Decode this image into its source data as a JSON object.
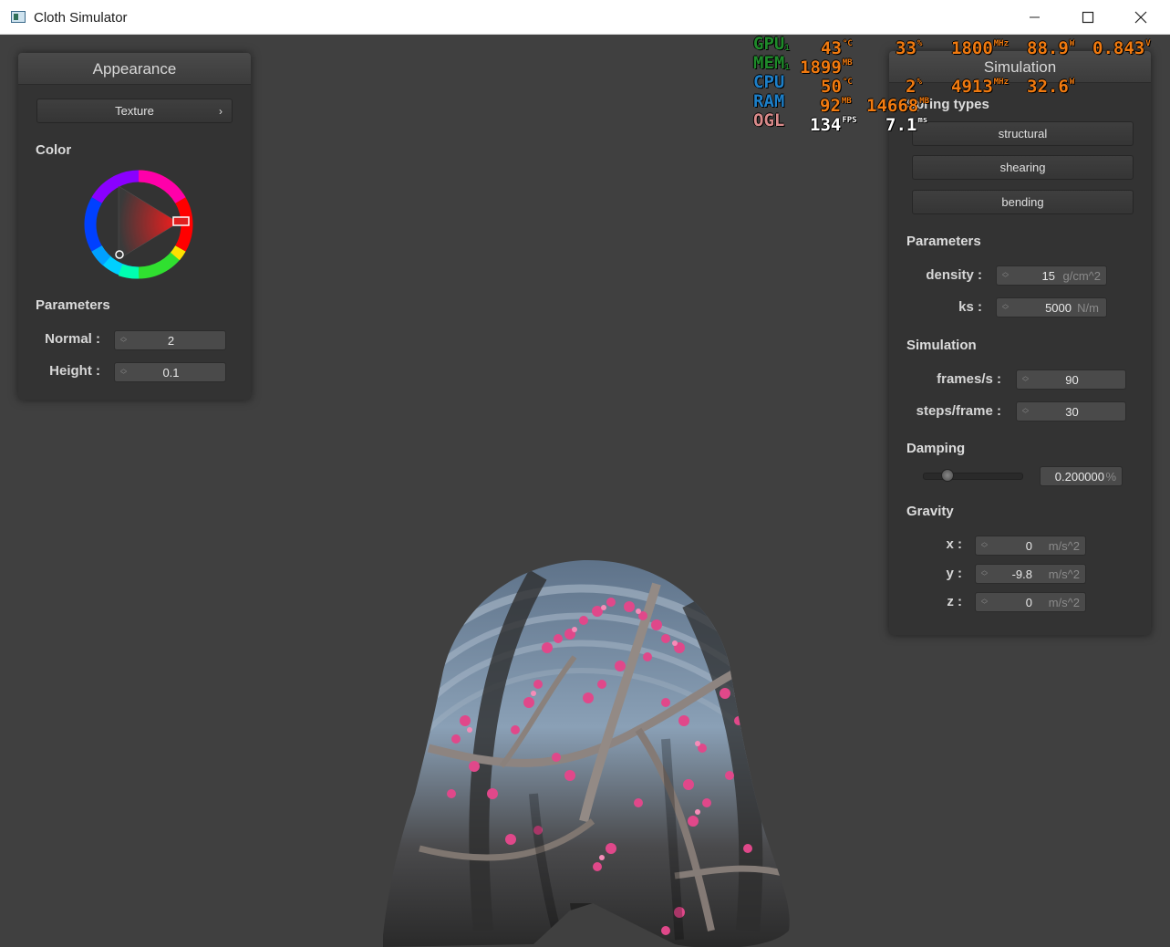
{
  "window": {
    "title": "Cloth Simulator"
  },
  "appearance": {
    "header": "Appearance",
    "texture_button": "Texture",
    "color_label": "Color",
    "color_value": "#d81e1e",
    "parameters_label": "Parameters",
    "normal_label": "Normal :",
    "normal_value": "2",
    "height_label": "Height :",
    "height_value": "0.1"
  },
  "simulation": {
    "header": "Simulation",
    "spring_types_label": "Spring types",
    "buttons": [
      "structural",
      "shearing",
      "bending"
    ],
    "parameters_label": "Parameters",
    "density_label": "density :",
    "density_value": "15",
    "density_unit": "g/cm^2",
    "ks_label": "ks :",
    "ks_value": "5000",
    "ks_unit": "N/m",
    "simulation_label": "Simulation",
    "fps_label": "frames/s :",
    "fps_value": "90",
    "steps_label": "steps/frame :",
    "steps_value": "30",
    "damping_label": "Damping",
    "damping_value": "0.200000",
    "damping_unit": "%",
    "damping_slider_fraction": 0.2,
    "gravity_label": "Gravity",
    "gx_label": "x :",
    "gx_value": "0",
    "gy_label": "y :",
    "gy_value": "-9.8",
    "gz_label": "z :",
    "gz_value": "0",
    "gravity_unit": "m/s^2"
  },
  "osd": {
    "gpu": {
      "label": "GPU",
      "sub": "1",
      "temp": "43",
      "temp_unit": "°C",
      "load": "33",
      "load_unit": "%",
      "clock": "1800",
      "clock_unit": "MHz",
      "power": "88.9",
      "power_unit": "W",
      "volt": "0.843",
      "volt_unit": "V"
    },
    "mem": {
      "label": "MEM",
      "sub": "1",
      "used": "1899",
      "used_unit": "MB"
    },
    "cpu": {
      "label": "CPU",
      "temp": "50",
      "temp_unit": "°C",
      "load": "2",
      "load_unit": "%",
      "clock": "4913",
      "clock_unit": "MHz",
      "power": "32.6",
      "power_unit": "W"
    },
    "ram": {
      "label": "RAM",
      "used": "92",
      "used_unit": "MB",
      "total": "14668",
      "total_unit": "MB"
    },
    "ogl": {
      "label": "OGL",
      "fps": "134",
      "fps_unit": "FPS",
      "ms": "7.1",
      "ms_unit": "ms"
    },
    "colors": {
      "gpu": "#1f8a2a",
      "mem": "#1f8a2a",
      "cpu": "#1d7fc8",
      "ram": "#1d7fc8",
      "ogl": "#d98a8a",
      "value": "#f07a10",
      "white": "#ffffff"
    }
  }
}
